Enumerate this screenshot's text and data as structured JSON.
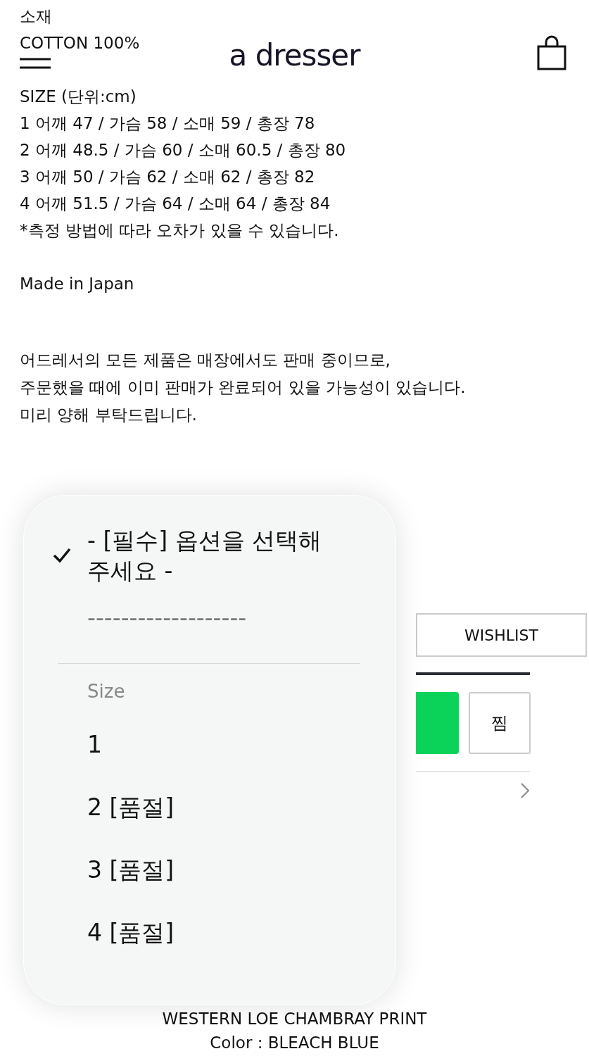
{
  "header": {
    "logo": "a dresser"
  },
  "material": {
    "label": "소재",
    "value": "COTTON 100%"
  },
  "size_chart": {
    "title": "SIZE (단위:cm)",
    "rows": [
      "1 어깨 47 / 가슴 58 / 소매 59 / 총장 78",
      "2 어깨 48.5 / 가슴 60 / 소매 60.5 / 총장 80",
      "3 어깨 50 / 가슴 62 / 소매 62 / 총장 82",
      "4 어깨 51.5 / 가슴 64 / 소매 64 / 총장 84"
    ],
    "note": "*측정 방법에 따라 오차가 있을 수 있습니다."
  },
  "origin": "Made in Japan",
  "notice": "어드레서의 모든 제품은 매장에서도 판매 중이므로,\n주문했을 때에 이미 판매가 완료되어 있을 가능성이 있습니다.\n미리 양해 부탁드립니다.",
  "actions": {
    "wishlist": "WISHLIST",
    "like": "찜"
  },
  "product": {
    "name": "WESTERN LOE CHAMBRAY PRINT",
    "color_text": "Color : BLEACH BLUE"
  },
  "dropdown": {
    "items": [
      {
        "kind": "option",
        "label": "- [필수] 옵션을 선택해 주세요 -",
        "selected": true,
        "disabled": false
      },
      {
        "kind": "option",
        "label": "-------------------",
        "selected": false,
        "disabled": true
      },
      {
        "kind": "separator"
      },
      {
        "kind": "group",
        "label": "Size"
      },
      {
        "kind": "option",
        "label": "1",
        "selected": false,
        "disabled": false
      },
      {
        "kind": "option",
        "label": "2 [품절]",
        "selected": false,
        "disabled": false
      },
      {
        "kind": "option",
        "label": "3 [품절]",
        "selected": false,
        "disabled": false
      },
      {
        "kind": "option",
        "label": "4 [품절]",
        "selected": false,
        "disabled": false
      }
    ]
  }
}
